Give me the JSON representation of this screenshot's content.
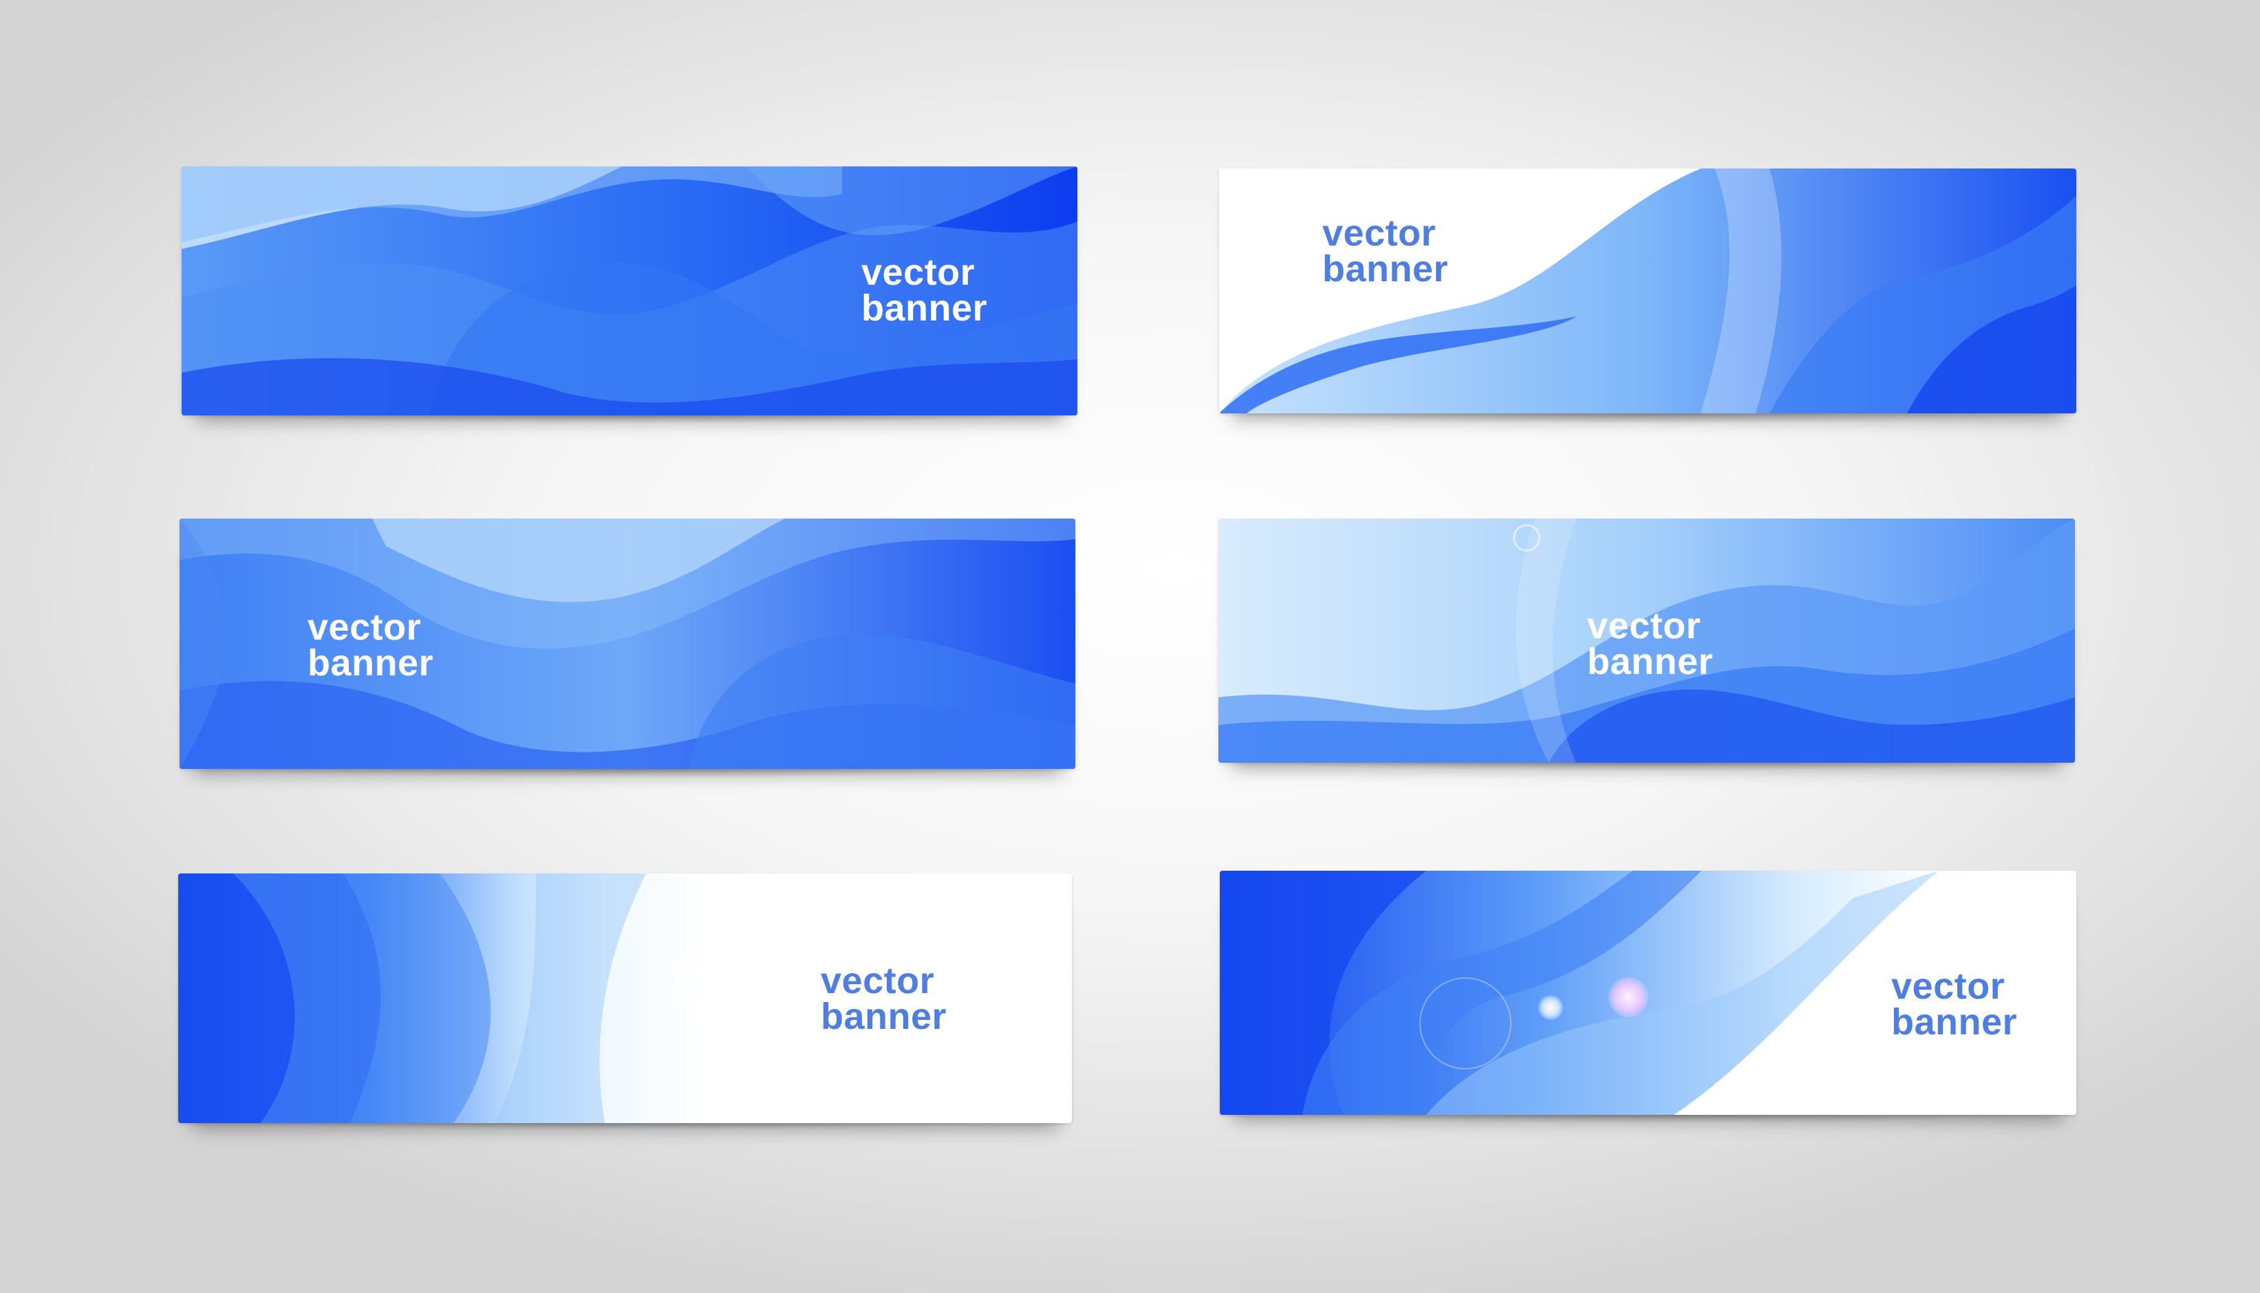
{
  "banners": [
    {
      "line1": "vector",
      "line2": "banner",
      "text_color": "#ffffff"
    },
    {
      "line1": "vector",
      "line2": "banner",
      "text_color": "#4f7ee3"
    },
    {
      "line1": "vector",
      "line2": "banner",
      "text_color": "#ffffff"
    },
    {
      "line1": "vector",
      "line2": "banner",
      "text_color": "#ffffff"
    },
    {
      "line1": "vector",
      "line2": "banner",
      "text_color": "#4f7ee3"
    },
    {
      "line1": "vector",
      "line2": "banner",
      "text_color": "#4f7ee3"
    }
  ],
  "colors": {
    "deep_blue": "#0a3cf0",
    "mid_blue": "#3c86f6",
    "light_blue": "#b9dcfb",
    "background": "#eeeeee"
  }
}
